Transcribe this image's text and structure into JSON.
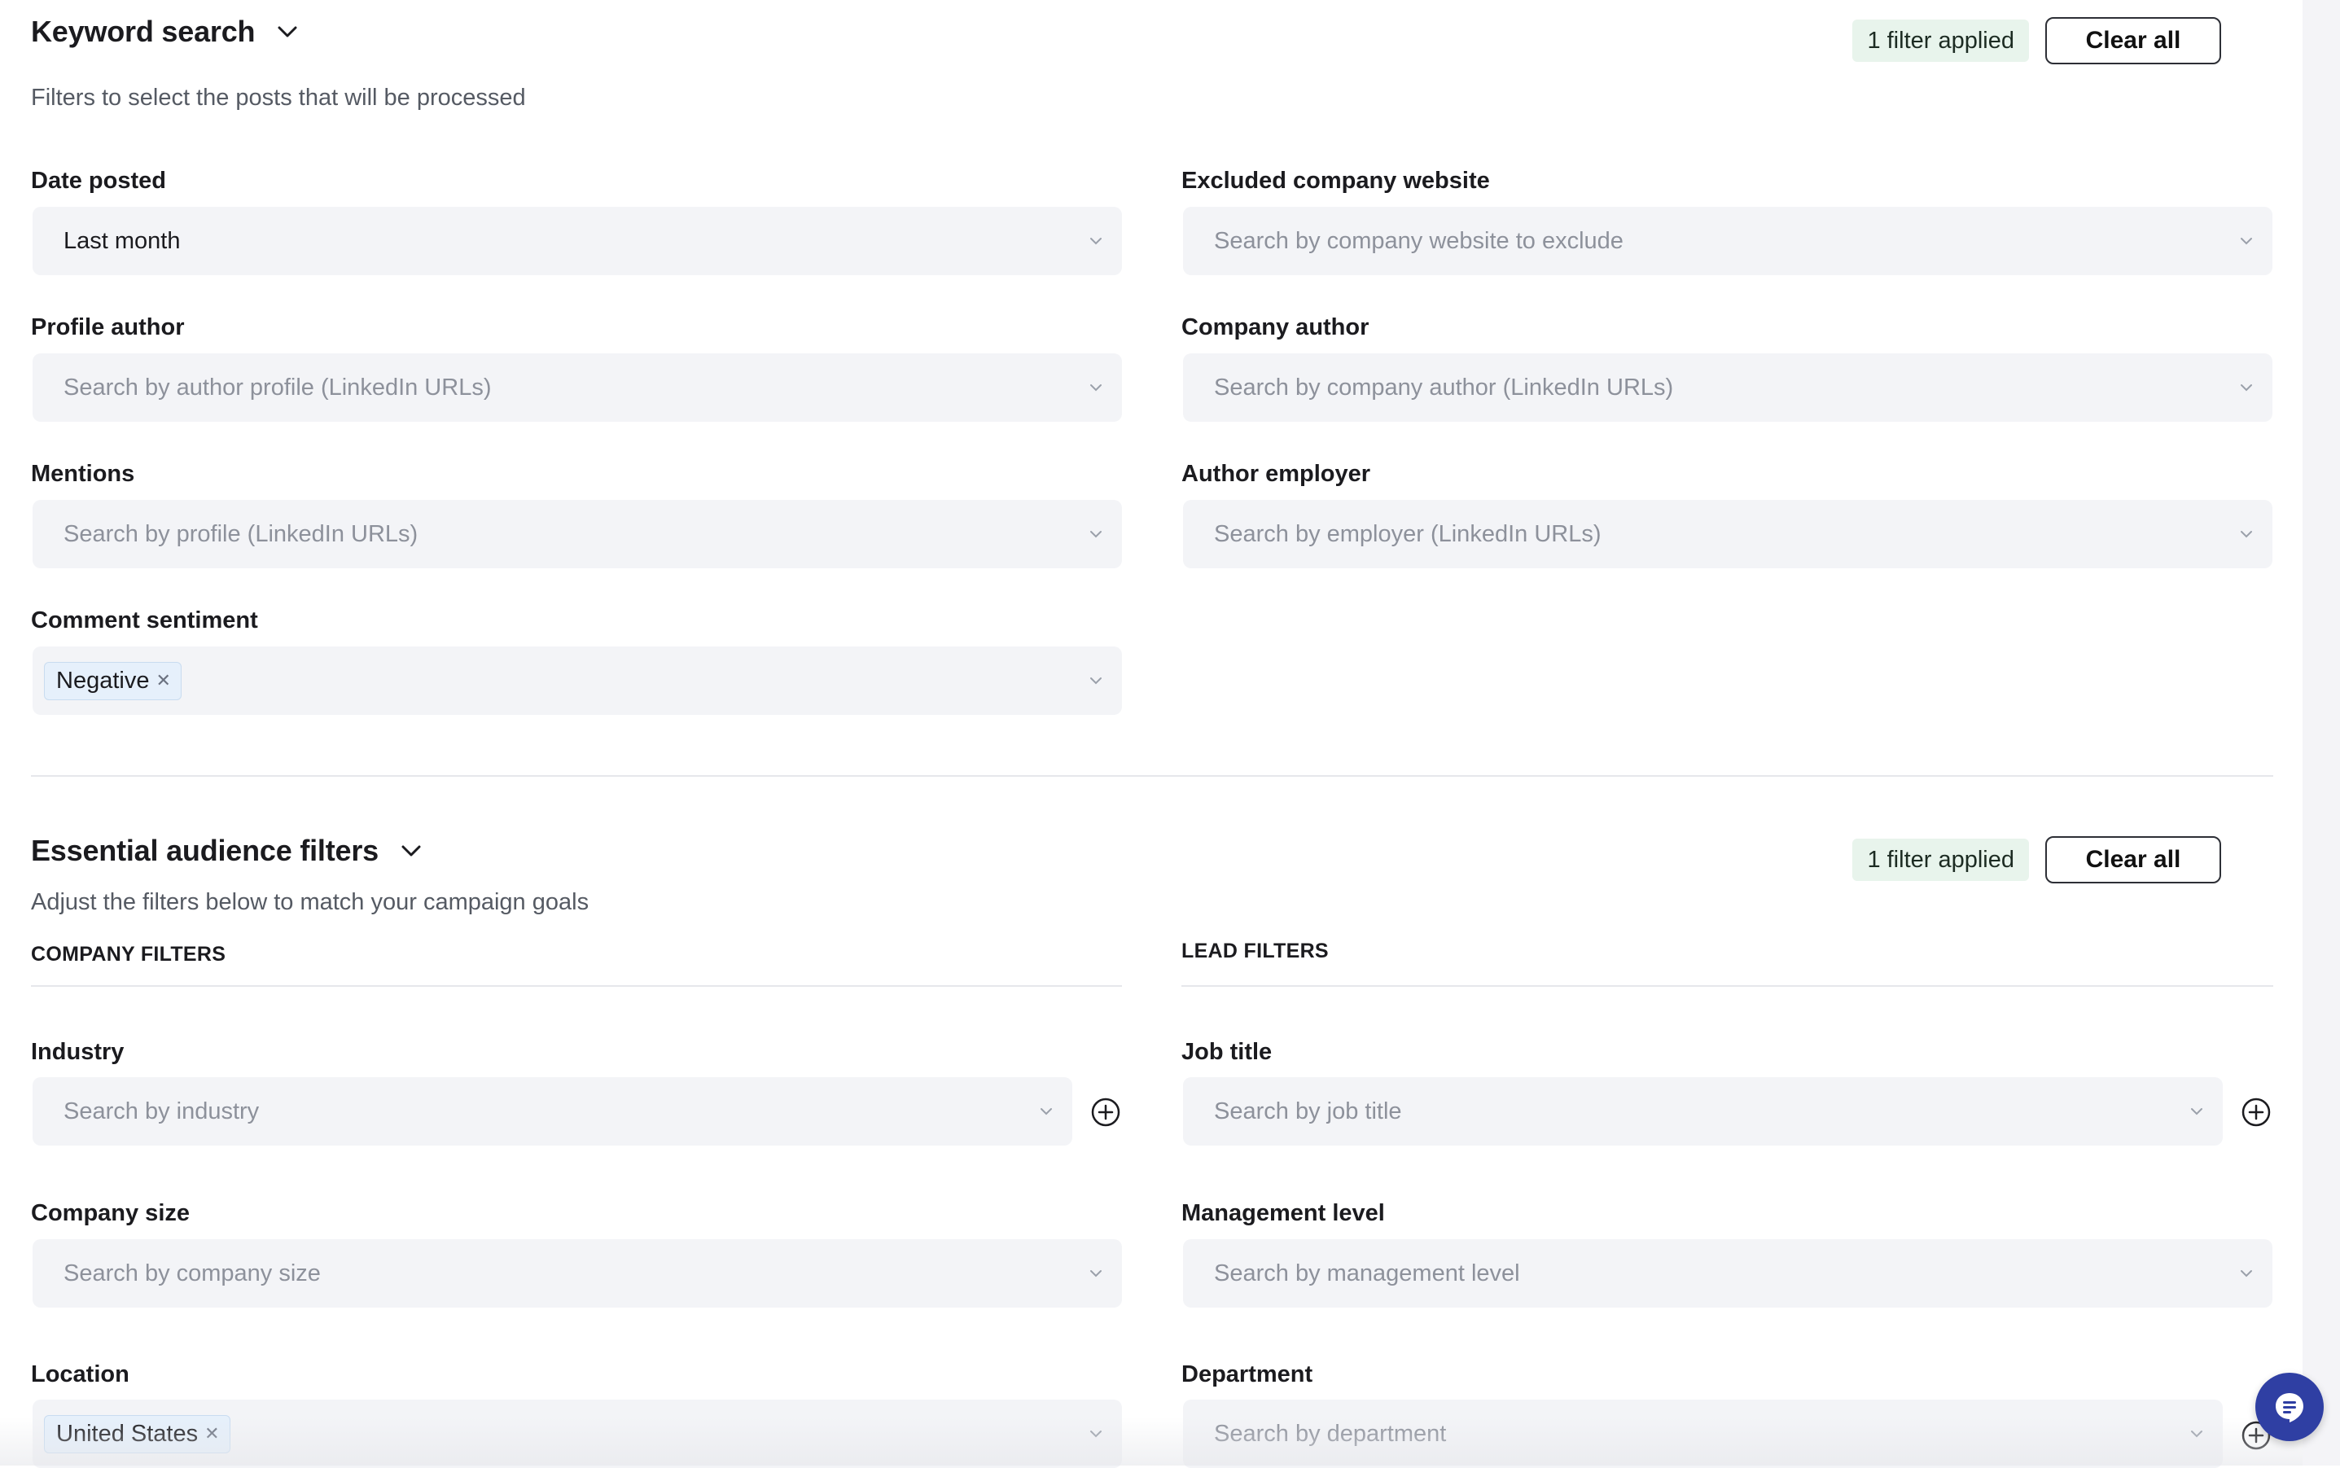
{
  "keyword_section": {
    "title": "Keyword search",
    "subtitle": "Filters to select the posts that will be processed",
    "filter_badge": "1 filter applied",
    "clear_label": "Clear all",
    "fields": {
      "date_posted": {
        "label": "Date posted",
        "value": "Last month"
      },
      "excluded_company_website": {
        "label": "Excluded company website",
        "placeholder": "Search by company website to exclude"
      },
      "profile_author": {
        "label": "Profile author",
        "placeholder": "Search by author profile (LinkedIn URLs)"
      },
      "company_author": {
        "label": "Company author",
        "placeholder": "Search by company author (LinkedIn URLs)"
      },
      "mentions": {
        "label": "Mentions",
        "placeholder": "Search by profile (LinkedIn URLs)"
      },
      "author_employer": {
        "label": "Author employer",
        "placeholder": "Search by employer (LinkedIn URLs)"
      },
      "comment_sentiment": {
        "label": "Comment sentiment",
        "chips": [
          "Negative"
        ]
      }
    }
  },
  "audience_section": {
    "title": "Essential audience filters",
    "subtitle": "Adjust the filters below to match your campaign goals",
    "filter_badge": "1 filter applied",
    "clear_label": "Clear all",
    "company_heading": "COMPANY FILTERS",
    "lead_heading": "LEAD FILTERS",
    "fields": {
      "industry": {
        "label": "Industry",
        "placeholder": "Search by industry"
      },
      "job_title": {
        "label": "Job title",
        "placeholder": "Search by job title"
      },
      "company_size": {
        "label": "Company size",
        "placeholder": "Search by company size"
      },
      "management_level": {
        "label": "Management level",
        "placeholder": "Search by management level"
      },
      "location": {
        "label": "Location",
        "chips": [
          "United States"
        ]
      },
      "department": {
        "label": "Department",
        "placeholder": "Search by department"
      }
    }
  },
  "icons": {
    "chevron": "chevron-down-icon",
    "select_arrow": "chevron-down-icon",
    "add": "plus-circle-icon",
    "chip_remove": "close-icon",
    "chat": "chat-icon"
  },
  "colors": {
    "badge_bg": "#e8f4ec",
    "field_bg": "#f3f4f7",
    "chat_button": "#2f3fa3"
  }
}
